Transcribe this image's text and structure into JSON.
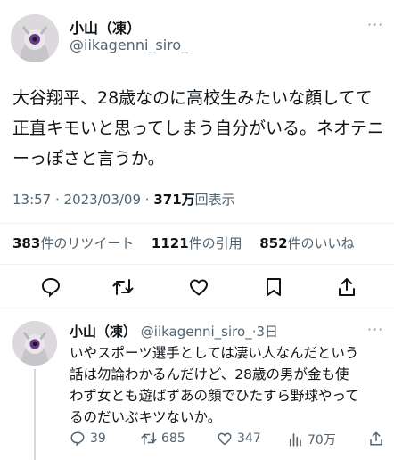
{
  "tweet": {
    "name": "小山（凍）",
    "handle": "@iikagenni_siro_",
    "more_label": "···",
    "text_lines": [
      "大谷翔平、28歳なのに高校生みたいな顔してて",
      "正直キモいと思ってしまう自分がいる。ネオテニ",
      "ーっぽさと言うか。"
    ],
    "time": "13:57",
    "date": "2023/03/09",
    "views": "371万",
    "views_label": "回表示",
    "sep": " · "
  },
  "stats": {
    "retweets": "383",
    "retweets_label": "件のリツイート",
    "quotes": "1121",
    "quotes_label": "件の引用",
    "likes": "852",
    "likes_label": "件のいいね"
  },
  "actions": [
    "reply-icon",
    "retweet-icon",
    "like-icon",
    "bookmark-icon",
    "share-icon"
  ],
  "reply": {
    "name": "小山（凍）",
    "handle": "@iikagenni_siro_",
    "age": "·3日",
    "more_label": "···",
    "text_lines": [
      "いやスポーツ選手としては凄い人なんだという",
      "話は勿論わかるんだけど、28歳の男が金も使",
      "わず女とも遊ばずあの顔でひたすら野球やって",
      "るのだいぶキツないか。"
    ],
    "counts": {
      "replies": "39",
      "retweets": "685",
      "likes": "347",
      "views": "70万"
    }
  },
  "colors": {
    "text": "#0f1419",
    "secondary": "#536471",
    "divider": "#eff3f4"
  }
}
